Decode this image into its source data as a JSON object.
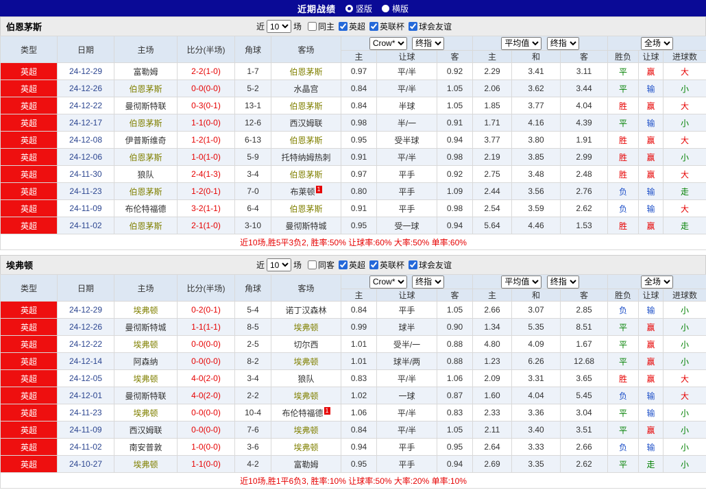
{
  "topbar": {
    "title": "近期战绩",
    "layout_options": [
      {
        "label": "竖版",
        "selected": true
      },
      {
        "label": "横版",
        "selected": false
      }
    ]
  },
  "colors": {
    "topbar_bg": "#0a0a96",
    "league_badge_bg": "#ee0f0f",
    "score_text": "#e60000",
    "focus_team_text": "#808000",
    "summary_text": "#e60000",
    "header_bg": "#dde7f3",
    "alt_row_bg": "#edf2f9",
    "outcome_map": {
      "胜": "#e60000",
      "赢": "#e60000",
      "大": "#e60000",
      "平": "#008000",
      "走": "#008000",
      "小": "#008000",
      "负": "#1e50c8",
      "输": "#1e50c8"
    }
  },
  "sections": [
    {
      "team": "伯恩茅斯",
      "filter": {
        "recent_prefix": "近",
        "recent_value": "10",
        "recent_suffix": "场",
        "same_venue": {
          "label": "同主",
          "checked": false
        },
        "leagues": [
          {
            "label": "英超",
            "checked": true
          },
          {
            "label": "英联杯",
            "checked": true
          },
          {
            "label": "球会友谊",
            "checked": true
          }
        ]
      },
      "header": {
        "type": "类型",
        "date": "日期",
        "home": "主场",
        "score": "比分(半场)",
        "corner": "角球",
        "away": "客场",
        "odds_company_select": "Crow*",
        "odds_stage_select": "终指",
        "odds_cols": [
          "主",
          "让球",
          "客"
        ],
        "avg_select": "平均值",
        "avg_stage_select": "终指",
        "avg_cols": [
          "主",
          "和",
          "客"
        ],
        "scope_select": "全场",
        "result_cols": [
          "胜负",
          "让球",
          "进球数"
        ]
      },
      "rows": [
        {
          "type": "英超",
          "date": "24-12-29",
          "home": "富勒姆",
          "score": "2-2(1-0)",
          "corner": "1-7",
          "away": "伯恩茅斯",
          "away_focus": true,
          "odds": [
            "0.97",
            "平/半",
            "0.92"
          ],
          "avg": [
            "2.29",
            "3.41",
            "3.11"
          ],
          "result": [
            "平",
            "赢",
            "大"
          ]
        },
        {
          "type": "英超",
          "date": "24-12-26",
          "home": "伯恩茅斯",
          "home_focus": true,
          "score": "0-0(0-0)",
          "corner": "5-2",
          "away": "水晶宫",
          "odds": [
            "0.84",
            "平/半",
            "1.05"
          ],
          "avg": [
            "2.06",
            "3.62",
            "3.44"
          ],
          "result": [
            "平",
            "输",
            "小"
          ]
        },
        {
          "type": "英超",
          "date": "24-12-22",
          "home": "曼彻斯特联",
          "score": "0-3(0-1)",
          "corner": "13-1",
          "away": "伯恩茅斯",
          "away_focus": true,
          "odds": [
            "0.84",
            "半球",
            "1.05"
          ],
          "avg": [
            "1.85",
            "3.77",
            "4.04"
          ],
          "result": [
            "胜",
            "赢",
            "大"
          ]
        },
        {
          "type": "英超",
          "date": "24-12-17",
          "home": "伯恩茅斯",
          "home_focus": true,
          "score": "1-1(0-0)",
          "corner": "12-6",
          "away": "西汉姆联",
          "odds": [
            "0.98",
            "半/一",
            "0.91"
          ],
          "avg": [
            "1.71",
            "4.16",
            "4.39"
          ],
          "result": [
            "平",
            "输",
            "小"
          ]
        },
        {
          "type": "英超",
          "date": "24-12-08",
          "home": "伊普斯维奇",
          "score": "1-2(1-0)",
          "corner": "6-13",
          "away": "伯恩茅斯",
          "away_focus": true,
          "odds": [
            "0.95",
            "受半球",
            "0.94"
          ],
          "avg": [
            "3.77",
            "3.80",
            "1.91"
          ],
          "result": [
            "胜",
            "赢",
            "大"
          ]
        },
        {
          "type": "英超",
          "date": "24-12-06",
          "home": "伯恩茅斯",
          "home_focus": true,
          "score": "1-0(1-0)",
          "corner": "5-9",
          "away": "托特纳姆热刺",
          "odds": [
            "0.91",
            "平/半",
            "0.98"
          ],
          "avg": [
            "2.19",
            "3.85",
            "2.99"
          ],
          "result": [
            "胜",
            "赢",
            "小"
          ]
        },
        {
          "type": "英超",
          "date": "24-11-30",
          "home": "狼队",
          "score": "2-4(1-3)",
          "corner": "3-4",
          "away": "伯恩茅斯",
          "away_focus": true,
          "odds": [
            "0.97",
            "平手",
            "0.92"
          ],
          "avg": [
            "2.75",
            "3.48",
            "2.48"
          ],
          "result": [
            "胜",
            "赢",
            "大"
          ]
        },
        {
          "type": "英超",
          "date": "24-11-23",
          "home": "伯恩茅斯",
          "home_focus": true,
          "score": "1-2(0-1)",
          "corner": "7-0",
          "away": "布莱顿",
          "away_sup": "1",
          "odds": [
            "0.80",
            "平手",
            "1.09"
          ],
          "avg": [
            "2.44",
            "3.56",
            "2.76"
          ],
          "result": [
            "负",
            "输",
            "走"
          ]
        },
        {
          "type": "英超",
          "date": "24-11-09",
          "home": "布伦特福德",
          "score": "3-2(1-1)",
          "corner": "6-4",
          "away": "伯恩茅斯",
          "away_focus": true,
          "odds": [
            "0.91",
            "平手",
            "0.98"
          ],
          "avg": [
            "2.54",
            "3.59",
            "2.62"
          ],
          "result": [
            "负",
            "输",
            "大"
          ]
        },
        {
          "type": "英超",
          "date": "24-11-02",
          "home": "伯恩茅斯",
          "home_focus": true,
          "score": "2-1(1-0)",
          "corner": "3-10",
          "away": "曼彻斯特城",
          "odds": [
            "0.95",
            "受一球",
            "0.94"
          ],
          "avg": [
            "5.64",
            "4.46",
            "1.53"
          ],
          "result": [
            "胜",
            "赢",
            "走"
          ]
        }
      ],
      "summary": "近10场,胜5平3负2, 胜率:50% 让球率:60% 大率:50% 单率:60%"
    },
    {
      "team": "埃弗顿",
      "filter": {
        "recent_prefix": "近",
        "recent_value": "10",
        "recent_suffix": "场",
        "same_venue": {
          "label": "同客",
          "checked": false
        },
        "leagues": [
          {
            "label": "英超",
            "checked": true
          },
          {
            "label": "英联杯",
            "checked": true
          },
          {
            "label": "球会友谊",
            "checked": true
          }
        ]
      },
      "header": {
        "type": "类型",
        "date": "日期",
        "home": "主场",
        "score": "比分(半场)",
        "corner": "角球",
        "away": "客场",
        "odds_company_select": "Crow*",
        "odds_stage_select": "终指",
        "odds_cols": [
          "主",
          "让球",
          "客"
        ],
        "avg_select": "平均值",
        "avg_stage_select": "终指",
        "avg_cols": [
          "主",
          "和",
          "客"
        ],
        "scope_select": "全场",
        "result_cols": [
          "胜负",
          "让球",
          "进球数"
        ]
      },
      "rows": [
        {
          "type": "英超",
          "date": "24-12-29",
          "home": "埃弗顿",
          "home_focus": true,
          "score": "0-2(0-1)",
          "corner": "5-4",
          "away": "诺丁汉森林",
          "odds": [
            "0.84",
            "平手",
            "1.05"
          ],
          "avg": [
            "2.66",
            "3.07",
            "2.85"
          ],
          "result": [
            "负",
            "输",
            "小"
          ]
        },
        {
          "type": "英超",
          "date": "24-12-26",
          "home": "曼彻斯特城",
          "score": "1-1(1-1)",
          "corner": "8-5",
          "away": "埃弗顿",
          "away_focus": true,
          "odds": [
            "0.99",
            "球半",
            "0.90"
          ],
          "avg": [
            "1.34",
            "5.35",
            "8.51"
          ],
          "result": [
            "平",
            "赢",
            "小"
          ]
        },
        {
          "type": "英超",
          "date": "24-12-22",
          "home": "埃弗顿",
          "home_focus": true,
          "score": "0-0(0-0)",
          "corner": "2-5",
          "away": "切尔西",
          "odds": [
            "1.01",
            "受半/一",
            "0.88"
          ],
          "avg": [
            "4.80",
            "4.09",
            "1.67"
          ],
          "result": [
            "平",
            "赢",
            "小"
          ]
        },
        {
          "type": "英超",
          "date": "24-12-14",
          "home": "阿森纳",
          "score": "0-0(0-0)",
          "corner": "8-2",
          "away": "埃弗顿",
          "away_focus": true,
          "odds": [
            "1.01",
            "球半/两",
            "0.88"
          ],
          "avg": [
            "1.23",
            "6.26",
            "12.68"
          ],
          "result": [
            "平",
            "赢",
            "小"
          ]
        },
        {
          "type": "英超",
          "date": "24-12-05",
          "home": "埃弗顿",
          "home_focus": true,
          "score": "4-0(2-0)",
          "corner": "3-4",
          "away": "狼队",
          "odds": [
            "0.83",
            "平/半",
            "1.06"
          ],
          "avg": [
            "2.09",
            "3.31",
            "3.65"
          ],
          "result": [
            "胜",
            "赢",
            "大"
          ]
        },
        {
          "type": "英超",
          "date": "24-12-01",
          "home": "曼彻斯特联",
          "score": "4-0(2-0)",
          "corner": "2-2",
          "away": "埃弗顿",
          "away_focus": true,
          "odds": [
            "1.02",
            "一球",
            "0.87"
          ],
          "avg": [
            "1.60",
            "4.04",
            "5.45"
          ],
          "result": [
            "负",
            "输",
            "大"
          ]
        },
        {
          "type": "英超",
          "date": "24-11-23",
          "home": "埃弗顿",
          "home_focus": true,
          "score": "0-0(0-0)",
          "corner": "10-4",
          "away": "布伦特福德",
          "away_sup": "1",
          "odds": [
            "1.06",
            "平/半",
            "0.83"
          ],
          "avg": [
            "2.33",
            "3.36",
            "3.04"
          ],
          "result": [
            "平",
            "输",
            "小"
          ]
        },
        {
          "type": "英超",
          "date": "24-11-09",
          "home": "西汉姆联",
          "score": "0-0(0-0)",
          "corner": "7-6",
          "away": "埃弗顿",
          "away_focus": true,
          "odds": [
            "0.84",
            "平/半",
            "1.05"
          ],
          "avg": [
            "2.11",
            "3.40",
            "3.51"
          ],
          "result": [
            "平",
            "赢",
            "小"
          ]
        },
        {
          "type": "英超",
          "date": "24-11-02",
          "home": "南安普敦",
          "score": "1-0(0-0)",
          "corner": "3-6",
          "away": "埃弗顿",
          "away_focus": true,
          "odds": [
            "0.94",
            "平手",
            "0.95"
          ],
          "avg": [
            "2.64",
            "3.33",
            "2.66"
          ],
          "result": [
            "负",
            "输",
            "小"
          ]
        },
        {
          "type": "英超",
          "date": "24-10-27",
          "home": "埃弗顿",
          "home_focus": true,
          "score": "1-1(0-0)",
          "corner": "4-2",
          "away": "富勒姆",
          "odds": [
            "0.95",
            "平手",
            "0.94"
          ],
          "avg": [
            "2.69",
            "3.35",
            "2.62"
          ],
          "result": [
            "平",
            "走",
            "小"
          ]
        }
      ],
      "summary": "近10场,胜1平6负3, 胜率:10% 让球率:50% 大率:20% 单率:10%"
    }
  ]
}
